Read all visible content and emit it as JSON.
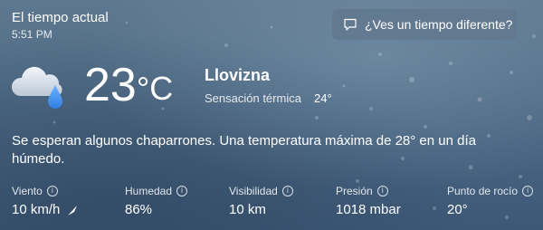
{
  "header": {
    "title": "El tiempo actual",
    "time": "5:51 PM",
    "cta_label": "¿Ves un tiempo diferente?"
  },
  "current": {
    "icon": "cloud-rain-icon",
    "temperature": "23",
    "unit": "°C",
    "condition": "Llovizna",
    "feels_like_label": "Sensación térmica",
    "feels_like_value": "24°"
  },
  "summary": "Se esperan algunos chaparrones. Una temperatura máxima de 28° en un día húmedo.",
  "stats": [
    {
      "label": "Viento",
      "value": "10 km/h",
      "icon": "wind-direction-arrow-icon"
    },
    {
      "label": "Humedad",
      "value": "86%"
    },
    {
      "label": "Visibilidad",
      "value": "10 km"
    },
    {
      "label": "Presión",
      "value": "1018 mbar"
    },
    {
      "label": "Punto de rocío",
      "value": "20°"
    }
  ],
  "colors": {
    "background": "#4e6a85",
    "button": "#62788e",
    "rain_drop": "#3c8ee8"
  }
}
